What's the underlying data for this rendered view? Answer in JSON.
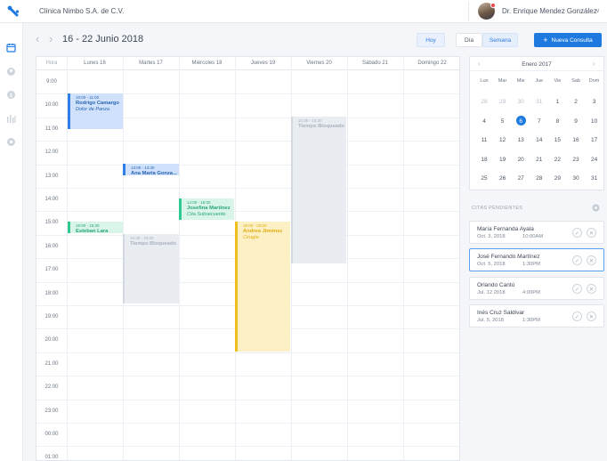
{
  "header": {
    "clinic_name": "Clínica Nimbo S.A. de C.V.",
    "user_name": "Dr. Enrique Mendez González"
  },
  "toolbar": {
    "range_title": "16 - 22 Junio 2018",
    "today_label": "Hoy",
    "day_label": "Día",
    "week_label": "Semana",
    "new_label": "Nueva Consulta",
    "accent_color": "#1f7ae0"
  },
  "calendar": {
    "hour_header": "Hora",
    "days": [
      "Lunes 16",
      "Martes 17",
      "Miércoles 18",
      "Jueves 19",
      "Viernes 20",
      "Sábado 21",
      "Domingo 22"
    ],
    "hours": [
      "9:00",
      "10:00",
      "11:00",
      "12:00",
      "13:00",
      "14:00",
      "15:00",
      "16:00",
      "17:00",
      "18:00",
      "19:00",
      "20:00",
      "21:00",
      "22:00",
      "23:00",
      "00:00",
      "01:00"
    ],
    "events": [
      {
        "time": "10:00 - 11:00",
        "name": "Rodrigo Camargo",
        "sub": "Dolor de Panza",
        "color": "blue"
      },
      {
        "time": "10:30 - 15:30",
        "name": "Tiempo Bloqueado",
        "sub": "",
        "color": "grey"
      },
      {
        "time": "13:00 - 13:30",
        "name": "Ana Maria Gonza...",
        "sub": "",
        "color": "blue"
      },
      {
        "time": "14:00 - 15:00",
        "name": "Josefina Martínez",
        "sub": "Cita Subsecuente",
        "color": "green"
      },
      {
        "time": "15:00 - 15:30",
        "name": "Esteban Lara",
        "sub": "",
        "color": "green"
      },
      {
        "time": "15:00 - 20:00",
        "name": "Andrea Jiménez",
        "sub": "Cirugía",
        "color": "yellow"
      },
      {
        "time": "15:30 - 18:30",
        "name": "Tiempo Bloqueado",
        "sub": "",
        "color": "grey"
      }
    ]
  },
  "mini_calendar": {
    "month_title": "Enero 2017",
    "weekdays": [
      "Lun",
      "Mar",
      "Mie",
      "Jue",
      "Vie",
      "Sab",
      "Dom"
    ],
    "weeks": [
      [
        "28",
        "29",
        "30",
        "31",
        "1",
        "2",
        "3"
      ],
      [
        "4",
        "5",
        "6",
        "7",
        "8",
        "9",
        "10"
      ],
      [
        "11",
        "12",
        "13",
        "14",
        "15",
        "16",
        "17"
      ],
      [
        "18",
        "19",
        "20",
        "21",
        "22",
        "23",
        "24"
      ],
      [
        "25",
        "26",
        "27",
        "28",
        "29",
        "30",
        "31"
      ]
    ],
    "selected_day": "6"
  },
  "pending": {
    "title": "CITAS PENDIENTES",
    "items": [
      {
        "name": "María Fernanda Ayala",
        "date": "Oct. 3, 2018",
        "time": "10:00AM"
      },
      {
        "name": "José Fernando Martínez",
        "date": "Oct. 5, 2018",
        "time": "1:30PM"
      },
      {
        "name": "Orlando Cantú",
        "date": "Jul. 12 2018",
        "time": "4:00PM"
      },
      {
        "name": "Inés Cruz Saldivar",
        "date": "Jul. 5, 2018",
        "time": "1:30PM"
      }
    ]
  }
}
